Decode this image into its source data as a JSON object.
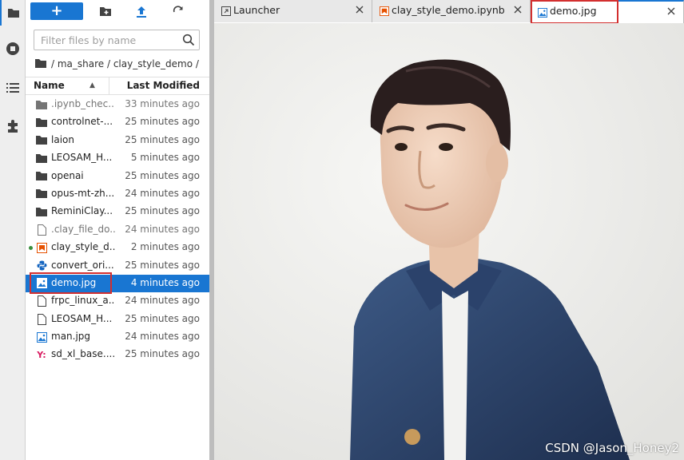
{
  "toolbar": {
    "new_label": "+"
  },
  "search": {
    "placeholder": "Filter files by name"
  },
  "breadcrumb": {
    "path": "/ ma_share / clay_style_demo /"
  },
  "list_header": {
    "name": "Name",
    "last_modified": "Last Modified"
  },
  "files": [
    {
      "name": ".ipynb_chec...",
      "modified": "33 minutes ago",
      "icon": "folder-icon"
    },
    {
      "name": "controlnet-...",
      "modified": "25 minutes ago",
      "icon": "folder-icon"
    },
    {
      "name": "laion",
      "modified": "25 minutes ago",
      "icon": "folder-icon"
    },
    {
      "name": "LEOSAM_H...",
      "modified": "5 minutes ago",
      "icon": "folder-icon"
    },
    {
      "name": "openai",
      "modified": "25 minutes ago",
      "icon": "folder-icon"
    },
    {
      "name": "opus-mt-zh...",
      "modified": "24 minutes ago",
      "icon": "folder-icon"
    },
    {
      "name": "ReminiClay...",
      "modified": "25 minutes ago",
      "icon": "folder-icon"
    },
    {
      "name": ".clay_file_do...",
      "modified": "24 minutes ago",
      "icon": "file-icon"
    },
    {
      "name": "clay_style_d...",
      "modified": "2 minutes ago",
      "icon": "notebook-icon"
    },
    {
      "name": "convert_ori...",
      "modified": "25 minutes ago",
      "icon": "python-icon"
    },
    {
      "name": "demo.jpg",
      "modified": "4 minutes ago",
      "icon": "image-icon"
    },
    {
      "name": "frpc_linux_a...",
      "modified": "24 minutes ago",
      "icon": "file-icon"
    },
    {
      "name": "LEOSAM_H...",
      "modified": "25 minutes ago",
      "icon": "file-icon"
    },
    {
      "name": "man.jpg",
      "modified": "24 minutes ago",
      "icon": "image-icon"
    },
    {
      "name": "sd_xl_base....",
      "modified": "25 minutes ago",
      "icon": "yaml-icon"
    }
  ],
  "tabs": [
    {
      "label": "Launcher",
      "icon": "launcher-icon"
    },
    {
      "label": "clay_style_demo.ipynb",
      "icon": "notebook-icon"
    },
    {
      "label": "demo.jpg",
      "icon": "image-icon"
    }
  ],
  "watermark": "CSDN @Jason_Honey2",
  "colors": {
    "accent": "#1976d2",
    "highlight": "#d32f2f",
    "notebook": "#e65100",
    "running": "#388e3c"
  }
}
